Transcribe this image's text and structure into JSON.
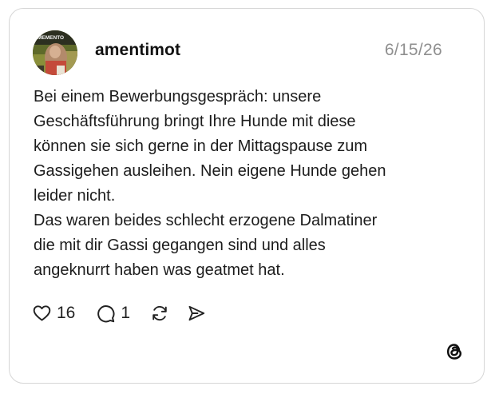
{
  "post": {
    "username": "amentimot",
    "date": "6/15/26",
    "avatar_badge_text": "MEMENTO",
    "body_lines": [
      "Bei einem Bewerbungsgespräch: unsere",
      "Geschäftsführung bringt Ihre Hunde mit diese",
      "können sie sich gerne in der Mittagspause zum",
      "Gassigehen ausleihen. Nein eigene Hunde gehen",
      "leider nicht.",
      "Das waren beides schlecht erzogene Dalmatiner",
      "die mit dir Gassi gegangen sind und alles",
      "angeknurrt haben was geatmet hat."
    ]
  },
  "actions": {
    "likes": "16",
    "replies": "1",
    "like_icon": "heart-icon",
    "reply_icon": "speech-bubble-icon",
    "repost_icon": "repost-icon",
    "share_icon": "send-icon"
  },
  "brand": {
    "logo": "threads-logo-icon"
  }
}
